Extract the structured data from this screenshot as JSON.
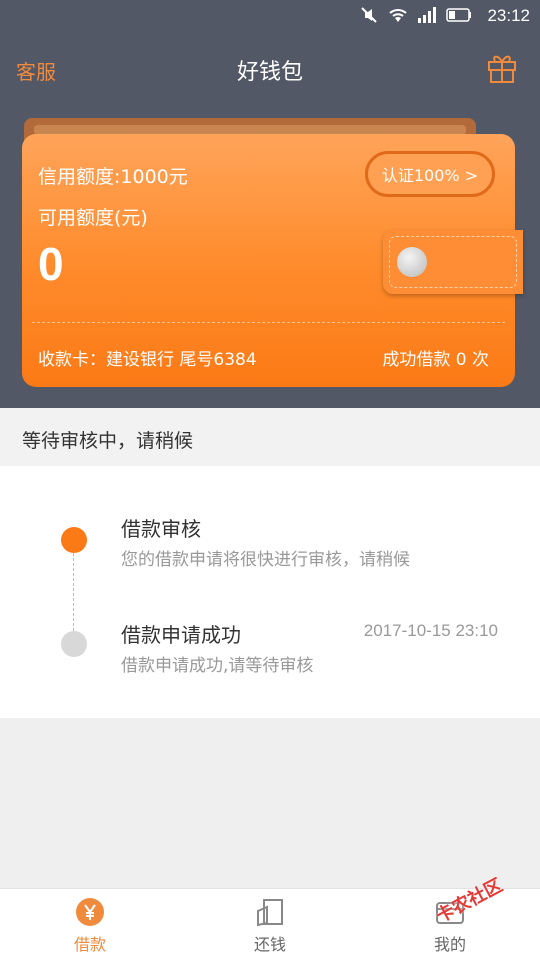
{
  "status": {
    "time": "23:12",
    "icons": [
      "mute-icon",
      "wifi-icon",
      "signal-icon",
      "battery-icon"
    ]
  },
  "nav": {
    "left": "客服",
    "title": "好钱包",
    "right_icon": "gift-icon"
  },
  "card": {
    "credit_limit": "信用额度:1000元",
    "certify": "认证100% >",
    "available_label": "可用额度(元)",
    "available_value": "0",
    "bank": "收款卡：建设银行 尾号6384",
    "success_count": "成功借款 0 次"
  },
  "banner": "等待审核中，请稍候",
  "timeline": [
    {
      "title": "借款审核",
      "desc": "您的借款申请将很快进行审核，请稍候",
      "time": "",
      "state": "active"
    },
    {
      "title": "借款申请成功",
      "desc": "借款申请成功,请等待审核",
      "time": "2017-10-15 23:10",
      "state": "done"
    }
  ],
  "tabs": [
    {
      "label": "借款",
      "icon": "yen-icon",
      "active": true
    },
    {
      "label": "还钱",
      "icon": "repay-icon",
      "active": false
    },
    {
      "label": "我的",
      "icon": "profile-icon",
      "active": false
    }
  ],
  "watermark": "卡农社区",
  "colors": {
    "accent": "#f08a3c",
    "header": "#525866",
    "card": "#ff8a2a"
  }
}
